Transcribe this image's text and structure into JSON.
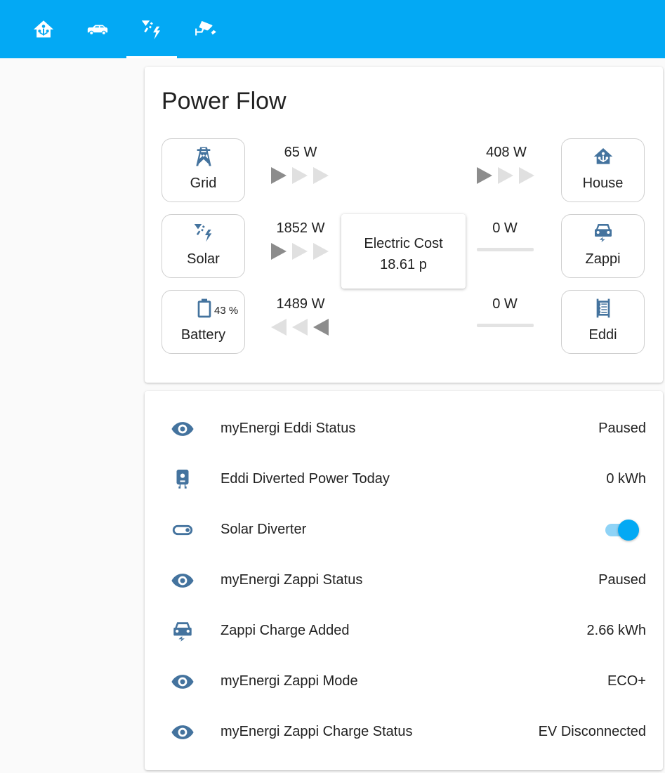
{
  "tabs": [
    {
      "icon": "home-automation-icon",
      "active": false
    },
    {
      "icon": "car-side-icon",
      "active": false
    },
    {
      "icon": "solar-power-icon",
      "active": true
    },
    {
      "icon": "cctv-icon",
      "active": false
    }
  ],
  "power_flow": {
    "title": "Power Flow",
    "grid": {
      "label": "Grid",
      "power": "65 W"
    },
    "solar": {
      "label": "Solar",
      "power": "1852 W"
    },
    "battery": {
      "label": "Battery",
      "power": "1489 W",
      "percent": "43 %"
    },
    "house": {
      "label": "House",
      "power": "408 W"
    },
    "zappi": {
      "label": "Zappi",
      "power": "0 W"
    },
    "eddi": {
      "label": "Eddi",
      "power": "0 W"
    },
    "cost": {
      "label": "Electric Cost",
      "value": "18.61 p"
    },
    "colors": {
      "active_arrow": "#8c8c8c",
      "inactive_arrow": "#e0e0e0",
      "icon": "#44739e"
    }
  },
  "entities": [
    {
      "icon": "eye-icon",
      "name": "myEnergi Eddi Status",
      "state": "Paused"
    },
    {
      "icon": "water-boiler-icon",
      "name": "Eddi Diverted Power Today",
      "state": "0 kWh"
    },
    {
      "icon": "toggle-switch-icon",
      "name": "Solar Diverter",
      "state": "on"
    },
    {
      "icon": "eye-icon",
      "name": "myEnergi Zappi Status",
      "state": "Paused"
    },
    {
      "icon": "car-electric-icon",
      "name": "Zappi Charge Added",
      "state": "2.66 kWh"
    },
    {
      "icon": "eye-icon",
      "name": "myEnergi Zappi Mode",
      "state": "ECO+"
    },
    {
      "icon": "eye-icon",
      "name": "myEnergi Zappi Charge Status",
      "state": "EV Disconnected"
    }
  ]
}
